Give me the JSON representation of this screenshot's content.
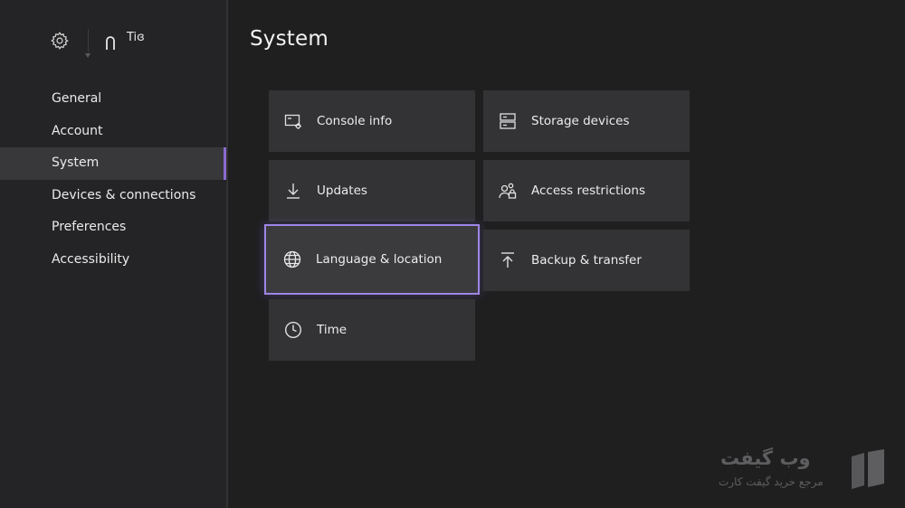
{
  "header": {
    "profile_name": "Tiɞ"
  },
  "sidebar": {
    "items": [
      {
        "label": "General"
      },
      {
        "label": "Account"
      },
      {
        "label": "System"
      },
      {
        "label": "Devices & connections"
      },
      {
        "label": "Preferences"
      },
      {
        "label": "Accessibility"
      }
    ],
    "active_item": "System"
  },
  "main": {
    "title": "System",
    "tiles": [
      {
        "label": "Console info",
        "icon": "console-info-icon"
      },
      {
        "label": "Storage devices",
        "icon": "storage-devices-icon"
      },
      {
        "label": "Updates",
        "icon": "download-icon"
      },
      {
        "label": "Access restrictions",
        "icon": "access-restrictions-icon"
      },
      {
        "label": "Language & location",
        "icon": "globe-icon"
      },
      {
        "label": "Backup & transfer",
        "icon": "upload-icon"
      },
      {
        "label": "Time",
        "icon": "clock-icon"
      }
    ],
    "focused_tile": "Language & location"
  },
  "watermark": {
    "title": "وب گیفت",
    "subtitle": "مرجع خرید گیفت کارت"
  },
  "colors": {
    "background": "#1f1f20",
    "sidebar": "#242426",
    "tile": "#333335",
    "accent": "#8a6bd0",
    "focus_ring": "#9d86e6"
  }
}
